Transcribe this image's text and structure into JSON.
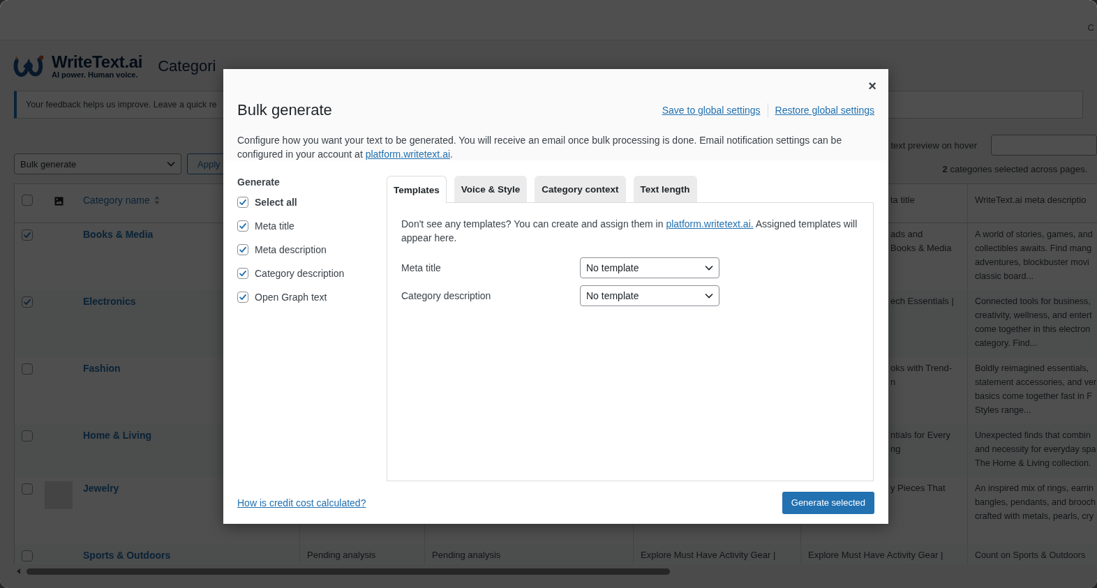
{
  "top_bar": {
    "text": "C"
  },
  "header": {
    "logo": {
      "name": "WriteText.ai",
      "tagline": "AI power. Human voice."
    },
    "page_title": "Categori"
  },
  "notice": {
    "text": "Your feedback helps us improve. Leave a quick re"
  },
  "toolbar": {
    "bulk_action": {
      "value": "Bulk generate"
    },
    "apply_button": "Apply",
    "preview_label": "text preview on hover",
    "selection_count": "**2** categories selected across pages."
  },
  "table": {
    "select_all": {
      "checked": false
    },
    "columns": [
      {
        "label": "Category name",
        "kind": "sortable"
      },
      {
        "label": "ta title",
        "kind": "meta_title"
      },
      {
        "label": "WriteText.ai meta descriptio",
        "kind": "meta_description"
      }
    ],
    "rows": [
      {
        "name": "Books & Media",
        "selected": true,
        "thumbnail": false,
        "meta_title": "ads and\nBooks & Media",
        "meta_description": "A world of stories, games, and\ncollectibles awaits. Find mang\nadventures, blockbuster movi\nclassic board..."
      },
      {
        "name": "Electronics",
        "selected": true,
        "thumbnail": false,
        "meta_title": "ech Essentials |",
        "meta_description": "Connected tools for business,\ncreativity, wellness, and entert\ncome together in this electron\ncategory. Find..."
      },
      {
        "name": "Fashion",
        "selected": false,
        "thumbnail": false,
        "meta_title": "oks with Trend-\nn",
        "meta_description": "Boldly reimagined essentials,\nstatement accessories, and ver\nbasics come together fast in F\nStyles range..."
      },
      {
        "name": "Home & Living",
        "selected": false,
        "thumbnail": false,
        "meta_title": "ntials for Every\nng",
        "meta_description": "Unexpected finds that combin\nand necessity for everyday spa\nThe Home & Living collection."
      },
      {
        "name": "Jewelry",
        "selected": false,
        "thumbnail": true,
        "meta_title": "y Pieces That",
        "meta_description": "An inspired mix of rings, earrin\nbangles, pendants, and brooch\ncrafted with metals, pearls, cry"
      },
      {
        "name": "Sports & Outdoors",
        "selected": false,
        "thumbnail": false,
        "column_4": "Pending analysis",
        "column_5": "Pending analysis",
        "column_6": "Explore Must Have Activity Gear |",
        "meta_title": "Explore Must Have Activity Gear |",
        "meta_description": "Count on Sports & Outdoors"
      }
    ]
  },
  "modal": {
    "close": "×",
    "title": "Bulk generate",
    "header_links": [
      "Save to global settings",
      "Restore global settings"
    ],
    "description": {
      "text": "Configure how you want your text to be generated. You will receive an email once bulk processing is done. Email notification settings can be configured in your account at",
      "link": "platform.writetext.ai",
      "after": "."
    },
    "generate": {
      "heading": "Generate",
      "options": [
        {
          "label": "Select all",
          "checked": true,
          "kind": "all"
        },
        {
          "label": "Meta title",
          "checked": true,
          "kind": "field"
        },
        {
          "label": "Meta description",
          "checked": true,
          "kind": "field"
        },
        {
          "label": "Category description",
          "checked": true,
          "kind": "field"
        },
        {
          "label": "Open Graph text",
          "checked": true,
          "kind": "field"
        }
      ]
    },
    "tabs": [
      {
        "label": "Templates",
        "selected": true
      },
      {
        "label": "Voice & Style",
        "selected": false
      },
      {
        "label": "Category context",
        "selected": false
      },
      {
        "label": "Text length",
        "selected": false
      }
    ],
    "templates": {
      "note": {
        "text": "Don't see any templates? You can create and assign them in",
        "link": "platform.writetext.ai.",
        "after": "Assigned templates will appear here."
      },
      "fields": [
        {
          "label": "Meta title",
          "value": "No template"
        },
        {
          "label": "Category description",
          "value": "No template"
        }
      ]
    },
    "help_link": "How is credit cost calculated?",
    "primary_button": "Generate selected"
  }
}
